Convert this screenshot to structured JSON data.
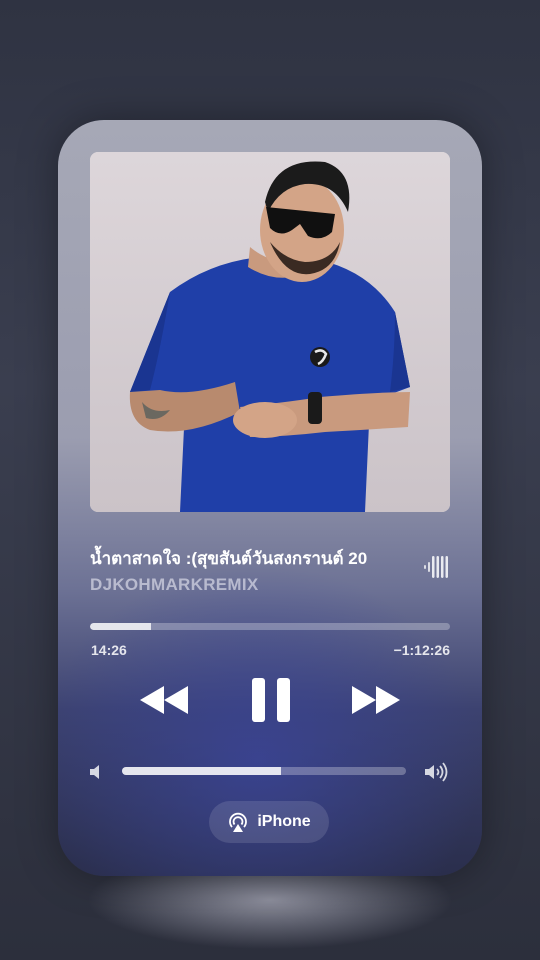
{
  "now_playing": {
    "title": "น้ำตาสาดใจ :(สุขสันต์วันสงกรานต์ 20",
    "artist": "DJKOHMARKREMIX",
    "artwork_icon": "album-artwork-person-in-blue-shirt"
  },
  "playback": {
    "elapsed": "14:26",
    "remaining": "−1:12:26",
    "progress_fraction": 0.17,
    "state": "playing"
  },
  "volume": {
    "level_fraction": 0.56
  },
  "output": {
    "device_label": "iPhone",
    "icon": "airplay-icon"
  },
  "icons": {
    "rewind": "rewind-icon",
    "pause": "pause-icon",
    "forward": "fast-forward-icon",
    "volume_low": "speaker-low-icon",
    "volume_high": "speaker-high-icon",
    "waveform": "waveform-icon"
  },
  "colors": {
    "accent_text": "#ffffff",
    "secondary_text": "#c6c7d6",
    "shirt_blue": "#1f3fa8"
  }
}
